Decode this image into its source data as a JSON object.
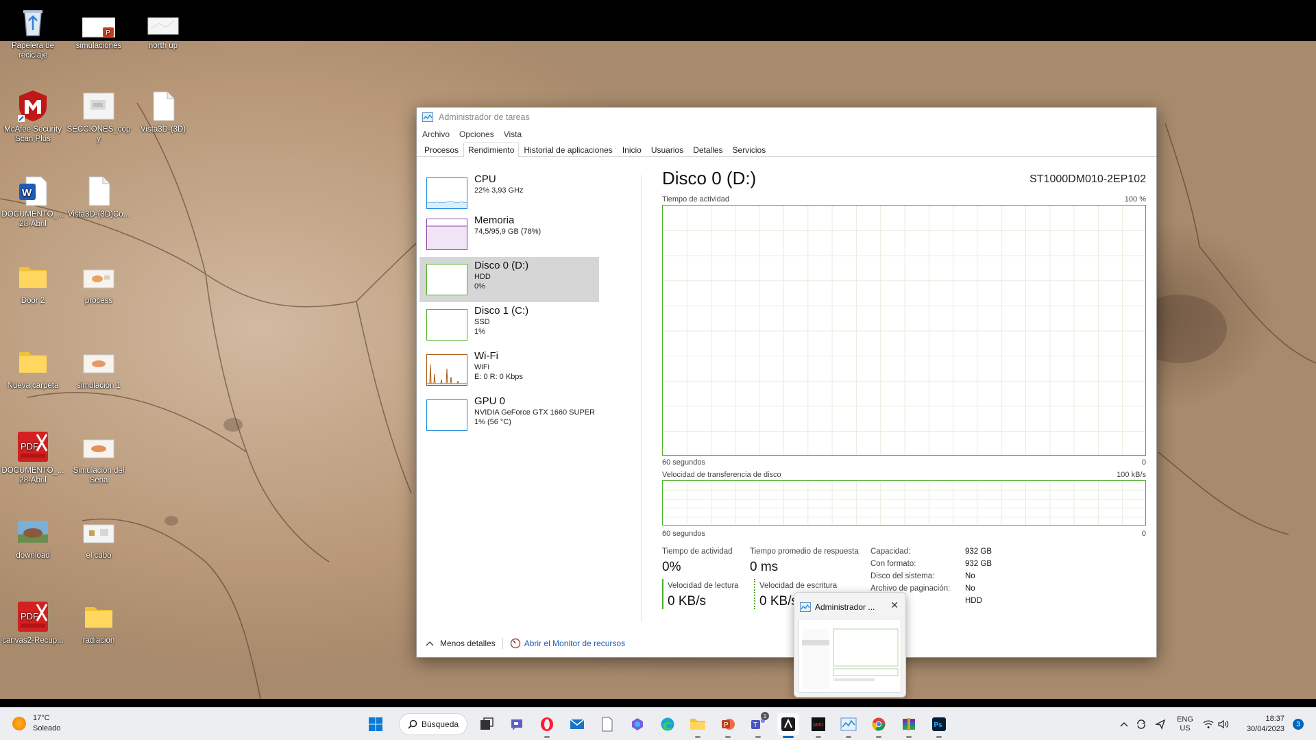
{
  "desktop": {
    "icons": [
      {
        "label": "Papelera de reciclaje"
      },
      {
        "label": "simulaciones"
      },
      {
        "label": "north up"
      },
      {
        "label": "McAfee Security Scan Plus"
      },
      {
        "label": "SECCIONES_copy"
      },
      {
        "label": "Vista3D-(3D)"
      },
      {
        "label": "DOCUMENTO_... 28-Abril"
      },
      {
        "label": "Vista3D-(3D)Co..."
      },
      {
        "label": "Door 2"
      },
      {
        "label": "process"
      },
      {
        "label": "Nueva carpeta"
      },
      {
        "label": "simulacion 1"
      },
      {
        "label": "DOCUMENTO_... 28-Abril"
      },
      {
        "label": "Simulacion del Sena"
      },
      {
        "label": "download"
      },
      {
        "label": "el cubo"
      },
      {
        "label": "canvas2-Recup..."
      },
      {
        "label": "radiacion"
      }
    ]
  },
  "window": {
    "title": "Administrador de tareas",
    "menu": [
      "Archivo",
      "Opciones",
      "Vista"
    ],
    "tabs": [
      "Procesos",
      "Rendimiento",
      "Historial de aplicaciones",
      "Inicio",
      "Usuarios",
      "Detalles",
      "Servicios"
    ],
    "active_tab": "Rendimiento"
  },
  "sidebar": {
    "items": [
      {
        "title": "CPU",
        "line1": "22%  3,93 GHz",
        "line2": "",
        "color": "#1b8ad6"
      },
      {
        "title": "Memoria",
        "line1": "74,5/95,9 GB (78%)",
        "line2": "",
        "color": "#8b3fa8"
      },
      {
        "title": "Disco 0 (D:)",
        "line1": "HDD",
        "line2": "0%",
        "color": "#4caf2b"
      },
      {
        "title": "Disco 1 (C:)",
        "line1": "SSD",
        "line2": "1%",
        "color": "#4caf2b"
      },
      {
        "title": "Wi-Fi",
        "line1": "WiFi",
        "line2": "E: 0  R: 0 Kbps",
        "color": "#a65a0f"
      },
      {
        "title": "GPU 0",
        "line1": "NVIDIA GeForce GTX 1660 SUPER",
        "line2": "1%  (56 °C)",
        "color": "#1b8ad6"
      }
    ],
    "selected": 2
  },
  "main": {
    "title": "Disco 0 (D:)",
    "model": "ST1000DM010-2EP102",
    "graph1": {
      "label": "Tiempo de actividad",
      "max": "100 %",
      "time_label": "60 segundos",
      "min": "0",
      "value": 0
    },
    "graph2": {
      "label": "Velocidad de transferencia de disco",
      "max": "100 kB/s",
      "time_label": "60 segundos",
      "min": "0",
      "value": 0
    },
    "stats": {
      "activity_label": "Tiempo de actividad",
      "activity_value": "0%",
      "response_label": "Tiempo promedio de respuesta",
      "response_value": "0 ms",
      "read_label": "Velocidad de lectura",
      "read_value": "0 KB/s",
      "write_label": "Velocidad de escritura",
      "write_value": "0 KB/s"
    },
    "properties": [
      {
        "key": "Capacidad:",
        "value": "932 GB"
      },
      {
        "key": "Con formato:",
        "value": "932 GB"
      },
      {
        "key": "Disco del sistema:",
        "value": "No"
      },
      {
        "key": "Archivo de paginación:",
        "value": "No"
      },
      {
        "key": "Tipo:",
        "value": "HDD"
      }
    ]
  },
  "footer": {
    "fewer_details": "Menos detalles",
    "open_monitor": "Abrir el Monitor de recursos"
  },
  "preview": {
    "title": "Administrador ..."
  },
  "taskbar": {
    "weather_temp": "17°C",
    "weather_desc": "Soleado",
    "search_label": "Búsqueda",
    "lang_line1": "ENG",
    "lang_line2": "US",
    "time": "18:37",
    "date": "30/04/2023",
    "notification_count": "3",
    "teams_badge": "1"
  },
  "colors": {
    "disk_green": "#4caf2b",
    "accent": "#0067c0"
  }
}
